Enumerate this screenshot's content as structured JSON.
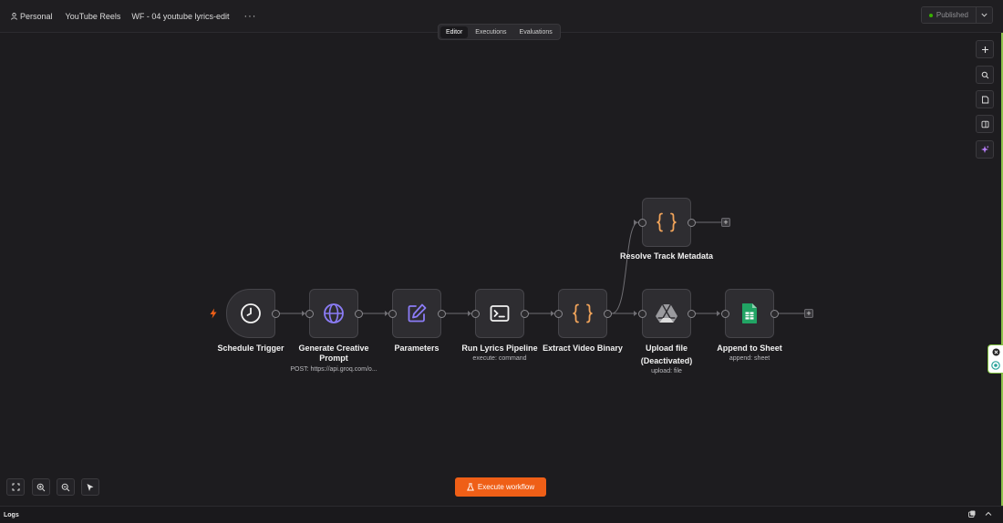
{
  "header": {
    "personal": "Personal",
    "folder": "YouTube Reels",
    "workflow_title": "WF - 04 youtube lyrics-edit",
    "more": "···",
    "published_label": "Published"
  },
  "tabs": [
    {
      "label": "Editor",
      "active": true
    },
    {
      "label": "Executions",
      "active": false
    },
    {
      "label": "Evaluations",
      "active": false
    }
  ],
  "nodes": {
    "schedule_trigger": {
      "label": "Schedule Trigger",
      "icon": "clock-icon"
    },
    "generate_prompt": {
      "label_line1": "Generate Creative",
      "label_line2": "Prompt",
      "sub": "POST: https://api.groq.com/o...",
      "icon": "globe-icon"
    },
    "parameters": {
      "label": "Parameters",
      "icon": "pencil-icon"
    },
    "run_lyrics": {
      "label": "Run Lyrics Pipeline",
      "sub": "execute: command",
      "icon": "terminal-icon"
    },
    "extract_video": {
      "label": "Extract Video Binary",
      "icon": "code-braces-icon"
    },
    "resolve_metadata": {
      "label": "Resolve Track Metadata",
      "icon": "code-braces-icon"
    },
    "upload_file": {
      "label_line1": "Upload file",
      "label_line2": "(Deactivated)",
      "sub": "upload: file",
      "icon": "google-drive-icon"
    },
    "append_sheet": {
      "label": "Append to Sheet",
      "sub": "append: sheet",
      "icon": "google-sheets-icon"
    }
  },
  "bottom": {
    "execute_label": "Execute workflow",
    "logs_label": "Logs"
  },
  "colors": {
    "accent_orange": "#ef5f17",
    "purple_icon": "#8b7cf6",
    "orange_braces": "#f0a35a",
    "sheets_green": "#21a464",
    "published_dot": "#38b000"
  }
}
